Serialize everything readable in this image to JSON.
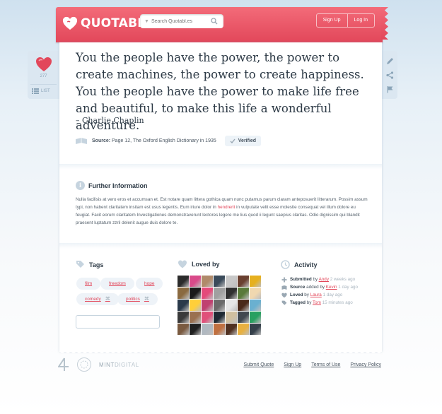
{
  "header": {
    "logo_text": "QUOTABL.ES",
    "search_placeholder": "Search Quotabl.es",
    "signup_label": "Sign Up",
    "login_label": "Log In"
  },
  "side": {
    "love_count": "277",
    "list_label": "LIST"
  },
  "quote": {
    "text": "You the people have the power, the power to create machines, the power to create happiness. You the people have the power to make life free and beautiful, to make this life a wonderful adventure.",
    "author": "– Charlie Chaplin",
    "source_label": "Source:",
    "source_text": "Page 12, The Oxford English Dictionary in 1935",
    "verified_label": "Verified"
  },
  "further": {
    "title": "Further Information",
    "body_before": "Nulla facilisis at vero eros et accumsan et. Est notare quam littera gothica quam nunc putamus parum claram anteposuerit litterarum. Possim assum typi, non habent claritatem insitam est usus legentis. Eum iriure dolor in ",
    "body_link": "hendrerit",
    "body_after": " in vulputate velit esse molestie consequat vel illum dolore eu feugiat. Facit eorum claritatem Investigationes demonstraverunt lectores legere me lius quod ii legunt saepius claritas. Odio dignissim qui blandit praesent luptatum zzril delenit augue duis dolore te."
  },
  "tags": {
    "title": "Tags",
    "items": [
      "film",
      "freedom",
      "hope",
      "comedy",
      "politics"
    ],
    "remove_symbol": "⌘",
    "add_label": "+"
  },
  "loved_by": {
    "title": "Loved by",
    "avatar_colors": [
      "#2b2b2b",
      "#d94a8a",
      "#b08a6a",
      "#3a4a5a",
      "#c8c8c8",
      "#6a4030",
      "#e6b020",
      "#8a6a40",
      "#1a1a1a",
      "#e44a7a",
      "#a0a0a0",
      "#303030",
      "#5a7a3a",
      "#f0d8b0",
      "#2a3a4a",
      "#ffcf3a",
      "#c04070",
      "#6a6a6a",
      "#e6e6e6",
      "#4a2a1a",
      "#6ab0d0",
      "#3a3a3a",
      "#9a7050",
      "#e0507a",
      "#1f2a33",
      "#d0c0a0",
      "#404850",
      "#28a060",
      "#7a5a40",
      "#202020",
      "#b0b8c0",
      "#c07040",
      "#503020",
      "#e8b040",
      "#35404a"
    ]
  },
  "activity": {
    "title": "Activity",
    "rows": [
      {
        "action": "Submitted",
        "by": "by",
        "user": "Andy",
        "time": "2 weeks ago"
      },
      {
        "action": "Source",
        "by": "added by",
        "user": "Kevin",
        "time": "1 day ago"
      },
      {
        "action": "Loved",
        "by": "by",
        "user": "Laura",
        "time": "1 day ago"
      },
      {
        "action": "Tagged",
        "by": "by",
        "user": "Tom",
        "time": "15 minutes ago"
      }
    ]
  },
  "footer": {
    "mint_a": "MINT",
    "mint_b": "DIGITAL",
    "links": [
      "Submit Quote",
      "Sign Up",
      "Terms of Use",
      "Privacy Policy"
    ]
  },
  "colors": {
    "brand": "#e2475a",
    "panel": "#dbe7f1"
  }
}
